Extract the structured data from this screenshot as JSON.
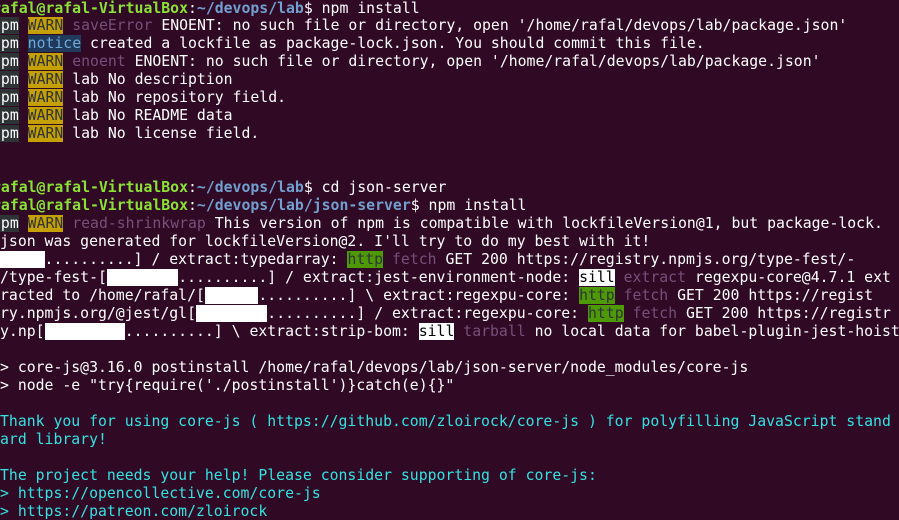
{
  "terminal": {
    "line0": {
      "user": "rafal@rafal-VirtualBox",
      "colon": ":",
      "path": "~/devops/lab",
      "prompt": "$ npm install"
    },
    "line1": {
      "prefix": "npm",
      "level": "WARN",
      "tag": "saveError",
      "text": " ENOENT: no such file or directory, open '/home/rafal/devops/lab/package.json'"
    },
    "line2": {
      "prefix": "npm",
      "level": "notice",
      "text": " created a lockfile as package-lock.json. You should commit this file."
    },
    "line3": {
      "prefix": "npm",
      "level": "WARN",
      "tag": "enoent",
      "text": " ENOENT: no such file or directory, open '/home/rafal/devops/lab/package.json'"
    },
    "line4": {
      "prefix": "npm",
      "level": "WARN",
      "text": " lab No description"
    },
    "line5": {
      "prefix": "npm",
      "level": "WARN",
      "text": " lab No repository field."
    },
    "line6": {
      "prefix": "npm",
      "level": "WARN",
      "text": " lab No README data"
    },
    "line7": {
      "prefix": "npm",
      "level": "WARN",
      "text": " lab No license field."
    },
    "line10": {
      "user": "rafal@rafal-VirtualBox",
      "colon": ":",
      "path": "~/devops/lab",
      "prompt": "$ cd json-server"
    },
    "line11": {
      "user": "rafal@rafal-VirtualBox",
      "colon": ":",
      "path": "~/devops/lab/json-server",
      "prompt": "$ npm install"
    },
    "line12": {
      "prefix": "npm",
      "level": "WARN",
      "tag": "read-shrinkwrap",
      "text": " This version of npm is compatible with lockfileVersion@1, but package-lock."
    },
    "line13": {
      "text": "json was generated for lockfileVersion@2. I'll try to do my best with it!"
    },
    "line14": {
      "a": "",
      "dots": "..........",
      "b": "] / extract:typedarray: ",
      "http": "http",
      "fetch": " fetch",
      "c": " GET 200 https://registry.npmjs.org/type-fest/-"
    },
    "line15": {
      "a": "/type-fest-[",
      "dots": "..........",
      "b": "] / extract:jest-environment-node: ",
      "sill": "sill",
      "extract": " extract",
      "c": " regexpu-core@4.7.1 ext"
    },
    "line16": {
      "a": "racted to /home/rafal/[",
      "dots": "..........",
      "b": "] \\ extract:regexpu-core: ",
      "http": "http",
      "fetch": " fetch",
      "c": " GET 200 https://regist"
    },
    "line17": {
      "a": "ry.npmjs.org/@jest/gl[",
      "dots": "..........",
      "b": "] / extract:regexpu-core: ",
      "http": "http",
      "fetch": " fetch",
      "c": " GET 200 https://registr"
    },
    "line18": {
      "a": "y.np[",
      "dots": "..........",
      "b": "] \\ extract:strip-bom: ",
      "sill": "sill",
      "tarball": " tarball",
      "c": " no local data for babel-plugin-jest-hoist"
    },
    "line20": {
      "text": "> core-js@3.16.0 postinstall /home/rafal/devops/lab/json-server/node_modules/core-js"
    },
    "line21": {
      "text": "> node -e \"try{require('./postinstall')}catch(e){}\""
    },
    "line23": {
      "text": "Thank you for using core-js ( https://github.com/zloirock/core-js ) for polyfilling JavaScript stand"
    },
    "line24": {
      "text": "ard library!"
    },
    "line26": {
      "text": "The project needs your help! Please consider supporting of core-js:"
    },
    "line27": {
      "text": "> https://opencollective.com/core-js"
    },
    "line28": {
      "text": "> https://patreon.com/zloirock"
    }
  }
}
